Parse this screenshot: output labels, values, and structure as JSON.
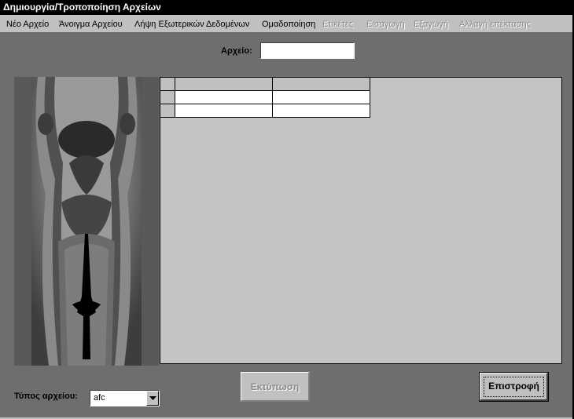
{
  "window": {
    "title": "Δημιουργία/Τροποποίηση Αρχείων"
  },
  "menu": [
    {
      "label": "Νέο Αρχείο",
      "enabled": true
    },
    {
      "label": "Άνοιγμα Αρχείου",
      "enabled": true
    },
    {
      "label": "Λήψη Εξωτερικών Δεδομένων",
      "enabled": true
    },
    {
      "label": "Ομαδοποίηση",
      "enabled": true
    },
    {
      "label": "Ετικέτες",
      "enabled": false
    },
    {
      "label": "Εισαγωγή",
      "enabled": false
    },
    {
      "label": "Εξαγωγή",
      "enabled": false
    },
    {
      "label": "Αλλαγή επέκτασης",
      "enabled": false
    }
  ],
  "file_field": {
    "label": "Αρχείο:",
    "value": ""
  },
  "grid": {
    "columns": [
      "",
      ""
    ],
    "rows": [
      [
        "",
        ""
      ],
      [
        "",
        ""
      ]
    ]
  },
  "file_type": {
    "label": "Τύπος αρχείου:",
    "selected": "afc"
  },
  "buttons": {
    "print_label": "Εκτύπωση",
    "print_enabled": false,
    "back_label": "Επιστροφή"
  },
  "colors": {
    "titlebar": "#000000",
    "client_background": "#6e6e6e",
    "grid_background": "#c4c4c4",
    "control_face": "#c0c0c0"
  },
  "icons": {
    "select_arrow": "chevron-down-icon"
  }
}
